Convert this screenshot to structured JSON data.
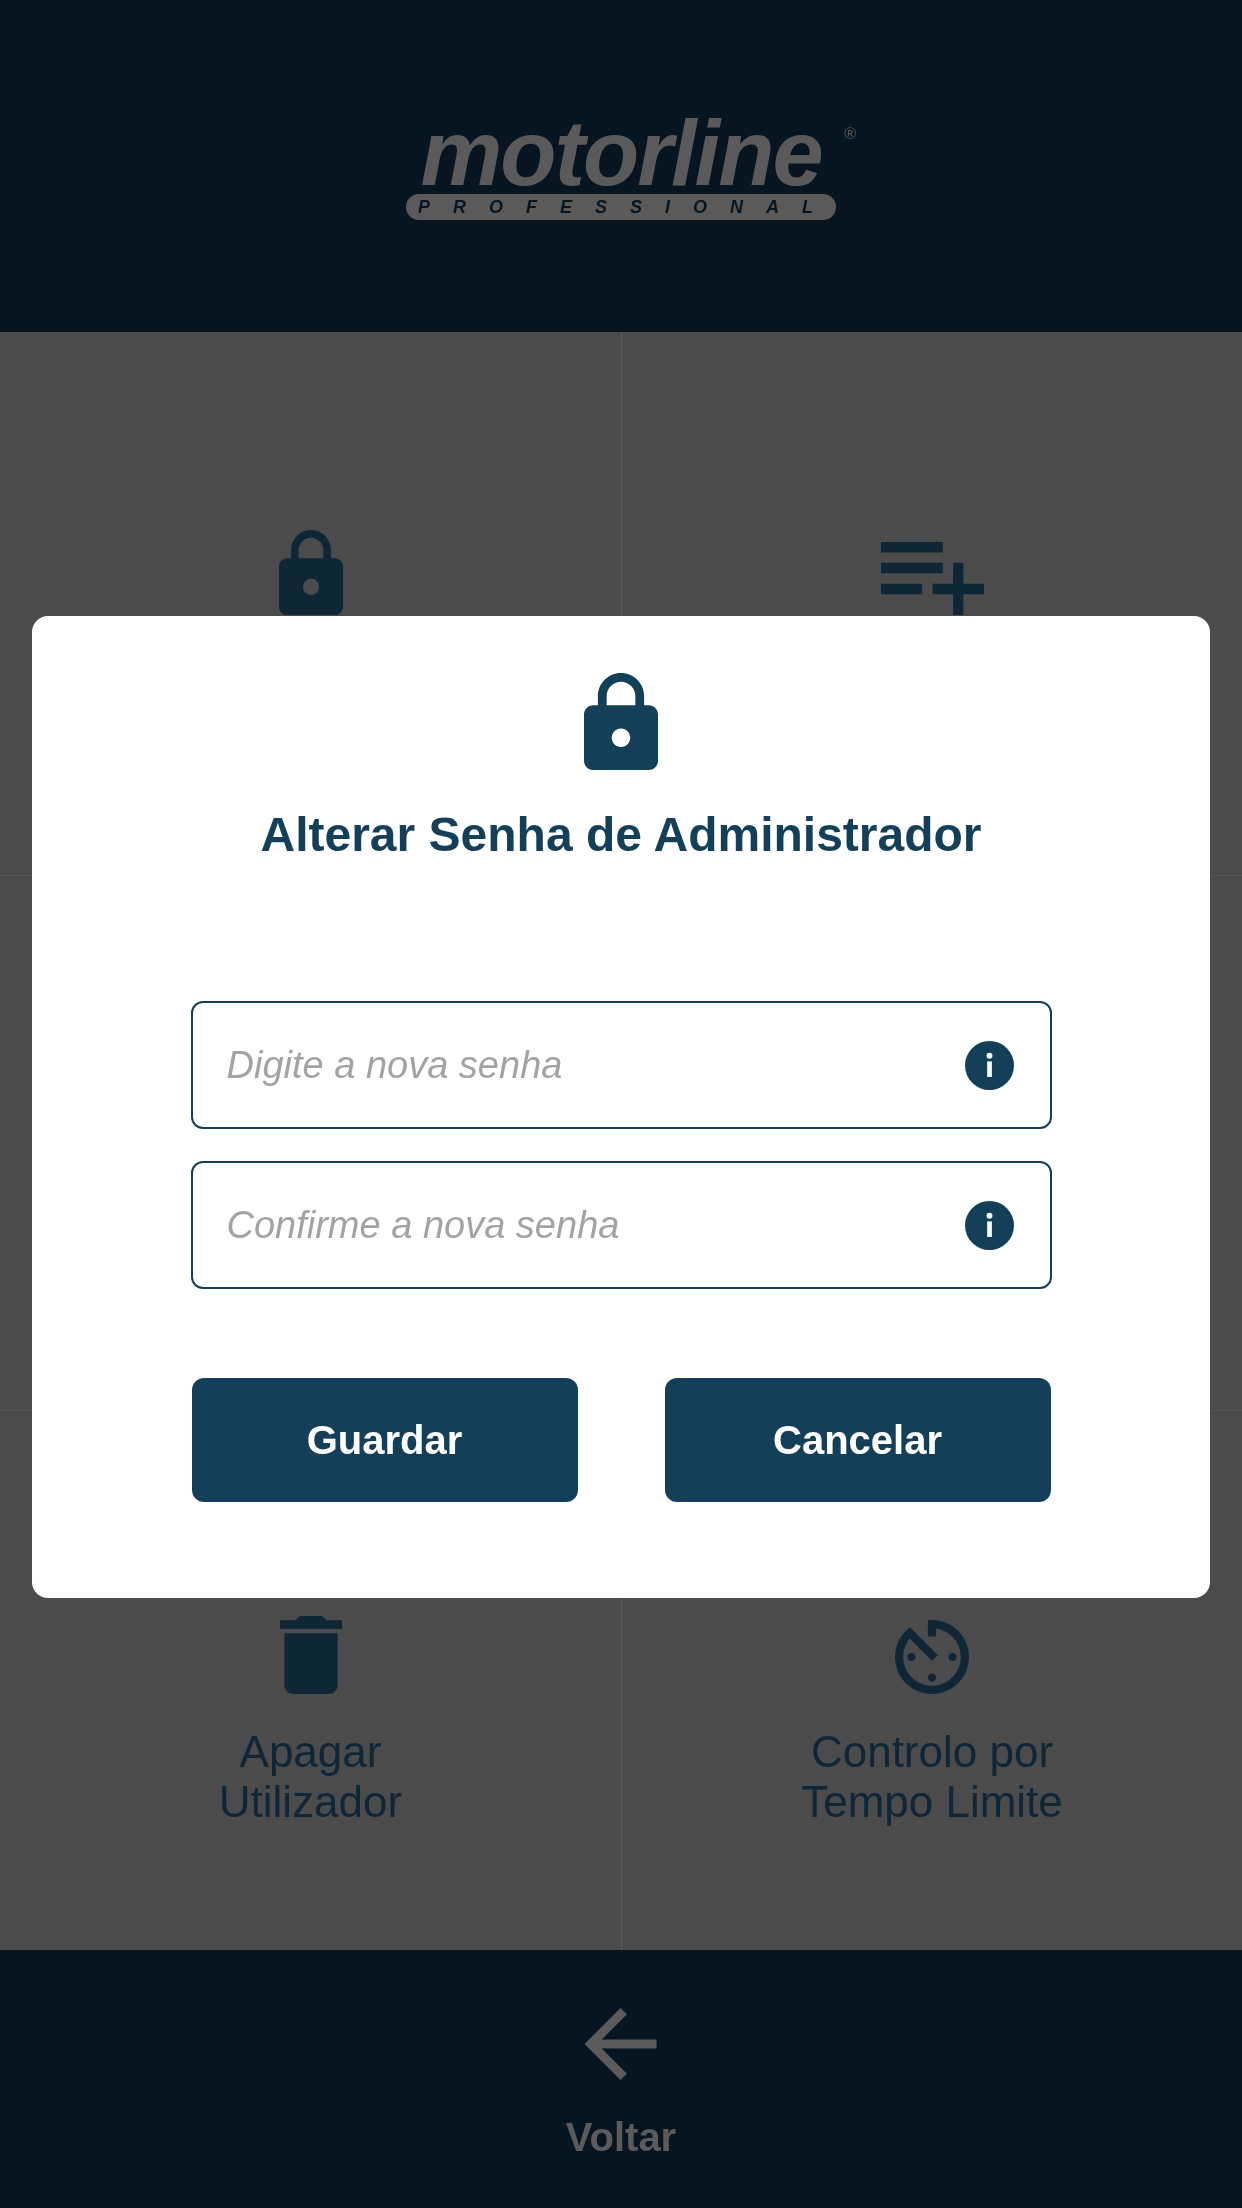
{
  "header": {
    "logo": {
      "wordmark": "motorline",
      "registered_mark": "®",
      "tagline": "PROFESSIONAL"
    }
  },
  "menu": {
    "tiles": [
      {
        "kind": "lock"
      },
      {
        "kind": "playlist"
      },
      {
        "kind": "trash",
        "label": "Apagar Utilizador"
      },
      {
        "kind": "timer",
        "label": "Controlo por Tempo Limite"
      }
    ]
  },
  "dialog": {
    "title": "Alterar Senha de Administrador",
    "fields": [
      {
        "placeholder": "Digite a nova senha"
      },
      {
        "placeholder": "Confirme a nova senha"
      }
    ],
    "buttons": [
      "Guardar",
      "Cancelar"
    ]
  },
  "bottom_bar": {
    "back_button": {
      "label": "Voltar"
    }
  }
}
